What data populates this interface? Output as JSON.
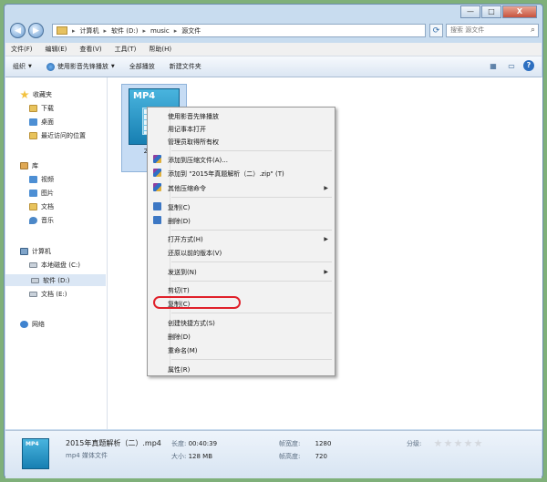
{
  "window": {
    "controls": {
      "minimize": "—",
      "maximize": "□",
      "close": "X"
    }
  },
  "nav": {
    "back": "◀",
    "forward": "▶",
    "breadcrumb": [
      "计算机",
      "软件 (D:)",
      "music",
      "源文件"
    ],
    "search_placeholder": "搜索 源文件"
  },
  "menubar": [
    "文件(F)",
    "编辑(E)",
    "查看(V)",
    "工具(T)",
    "帮助(H)"
  ],
  "toolbar": {
    "organize": "组织",
    "play": "使用影音先锋播放",
    "play_all": "全部播放",
    "new_folder": "新建文件夹"
  },
  "navpane": {
    "favorites": "收藏夹",
    "downloads": "下载",
    "desktop": "桌面",
    "recent": "最近访问的位置",
    "libraries": "库",
    "videos": "视频",
    "pictures": "图片",
    "documents": "文档",
    "music": "音乐",
    "computer": "计算机",
    "drive_c": "本地磁盘 (C:)",
    "drive_d": "软件 (D:)",
    "drive_e": "文档 (E:)",
    "network": "网络"
  },
  "file": {
    "icon_label": "MP4",
    "name_line1": "2015年",
    "name_line2": "（二"
  },
  "context_menu": {
    "items": [
      "使用影音先锋播放",
      "用记事本打开",
      "管理员取得所有权",
      "添加到压缩文件(A)...",
      "添加到 \"2015年真题解析（二）.zip\" (T)",
      "其他压缩命令",
      "复制(C)",
      "删除(D)",
      "打开方式(H)",
      "还原以前的版本(V)",
      "发送到(N)",
      "剪切(T)",
      "复制(C)",
      "创建快捷方式(S)",
      "删除(D)",
      "重命名(M)",
      "属性(R)"
    ]
  },
  "details": {
    "icon_label": "MP4",
    "name": "2015年真题解析（二）.mp4",
    "type": "mp4 媒体文件",
    "duration_label": "长度:",
    "duration": "00:40:39",
    "size_label": "大小:",
    "size": "128 MB",
    "frame_width_label": "帧宽度:",
    "frame_width": "1280",
    "frame_height_label": "帧高度:",
    "frame_height": "720",
    "rating_label": "分级:"
  },
  "colors": {
    "highlight": "#e0202a",
    "window": "#c8dcef"
  }
}
